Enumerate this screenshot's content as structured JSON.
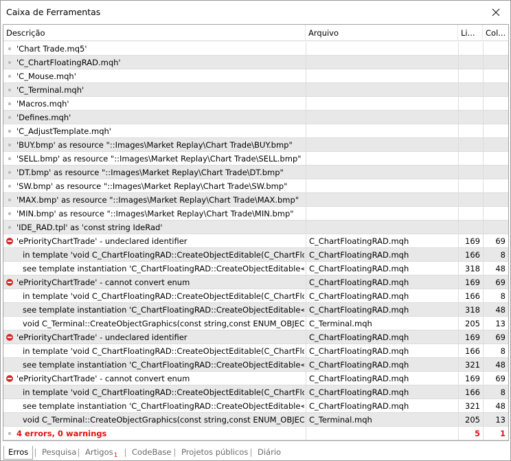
{
  "window": {
    "title": "Caixa de Ferramentas"
  },
  "columns": {
    "description": "Descrição",
    "file": "Arquivo",
    "line": "Li...",
    "col": "Col..."
  },
  "rows": [
    {
      "kind": "info",
      "bg": "white",
      "indent": false,
      "desc": "'Chart Trade.mq5'",
      "file": "",
      "line": "",
      "col": ""
    },
    {
      "kind": "info",
      "bg": "gray",
      "indent": false,
      "desc": "'C_ChartFloatingRAD.mqh'",
      "file": "",
      "line": "",
      "col": ""
    },
    {
      "kind": "info",
      "bg": "white",
      "indent": false,
      "desc": "'C_Mouse.mqh'",
      "file": "",
      "line": "",
      "col": ""
    },
    {
      "kind": "info",
      "bg": "gray",
      "indent": false,
      "desc": "'C_Terminal.mqh'",
      "file": "",
      "line": "",
      "col": ""
    },
    {
      "kind": "info",
      "bg": "white",
      "indent": false,
      "desc": "'Macros.mqh'",
      "file": "",
      "line": "",
      "col": ""
    },
    {
      "kind": "info",
      "bg": "gray",
      "indent": false,
      "desc": "'Defines.mqh'",
      "file": "",
      "line": "",
      "col": ""
    },
    {
      "kind": "info",
      "bg": "white",
      "indent": false,
      "desc": "'C_AdjustTemplate.mqh'",
      "file": "",
      "line": "",
      "col": ""
    },
    {
      "kind": "info",
      "bg": "gray",
      "indent": false,
      "desc": "'BUY.bmp' as resource \"::Images\\Market Replay\\Chart Trade\\BUY.bmp\"",
      "file": "",
      "line": "",
      "col": ""
    },
    {
      "kind": "info",
      "bg": "white",
      "indent": false,
      "desc": "'SELL.bmp' as resource \"::Images\\Market Replay\\Chart Trade\\SELL.bmp\"",
      "file": "",
      "line": "",
      "col": ""
    },
    {
      "kind": "info",
      "bg": "gray",
      "indent": false,
      "desc": "'DT.bmp' as resource \"::Images\\Market Replay\\Chart Trade\\DT.bmp\"",
      "file": "",
      "line": "",
      "col": ""
    },
    {
      "kind": "info",
      "bg": "white",
      "indent": false,
      "desc": "'SW.bmp' as resource \"::Images\\Market Replay\\Chart Trade\\SW.bmp\"",
      "file": "",
      "line": "",
      "col": ""
    },
    {
      "kind": "info",
      "bg": "gray",
      "indent": false,
      "desc": "'MAX.bmp' as resource \"::Images\\Market Replay\\Chart Trade\\MAX.bmp\"",
      "file": "",
      "line": "",
      "col": ""
    },
    {
      "kind": "info",
      "bg": "white",
      "indent": false,
      "desc": "'MIN.bmp' as resource \"::Images\\Market Replay\\Chart Trade\\MIN.bmp\"",
      "file": "",
      "line": "",
      "col": ""
    },
    {
      "kind": "info",
      "bg": "gray",
      "indent": false,
      "desc": "'IDE_RAD.tpl' as 'const string IdeRad'",
      "file": "",
      "line": "",
      "col": ""
    },
    {
      "kind": "error",
      "bg": "white",
      "indent": false,
      "desc": "'ePriorityChartTrade' - undeclared identifier",
      "file": "C_ChartFloatingRAD.mqh",
      "line": "169",
      "col": "69"
    },
    {
      "kind": "info",
      "bg": "gray",
      "indent": true,
      "desc": "in template 'void C_ChartFloatingRAD::CreateObjectEditable(C_ChartFloatin...",
      "file": "C_ChartFloatingRAD.mqh",
      "line": "166",
      "col": "8"
    },
    {
      "kind": "info",
      "bg": "white",
      "indent": true,
      "desc": "see template instantiation 'C_ChartFloatingRAD::CreateObjectEditable<shor...",
      "file": "C_ChartFloatingRAD.mqh",
      "line": "318",
      "col": "48"
    },
    {
      "kind": "error",
      "bg": "gray",
      "indent": false,
      "desc": "'ePriorityChartTrade' - cannot convert enum",
      "file": "C_ChartFloatingRAD.mqh",
      "line": "169",
      "col": "69"
    },
    {
      "kind": "info",
      "bg": "white",
      "indent": true,
      "desc": "in template 'void C_ChartFloatingRAD::CreateObjectEditable(C_ChartFloatin...",
      "file": "C_ChartFloatingRAD.mqh",
      "line": "166",
      "col": "8"
    },
    {
      "kind": "info",
      "bg": "gray",
      "indent": true,
      "desc": "see template instantiation 'C_ChartFloatingRAD::CreateObjectEditable<shor...",
      "file": "C_ChartFloatingRAD.mqh",
      "line": "318",
      "col": "48"
    },
    {
      "kind": "info",
      "bg": "white",
      "indent": true,
      "desc": "void C_Terminal::CreateObjectGraphics(const string,const ENUM_OBJECT,c...",
      "file": "C_Terminal.mqh",
      "line": "205",
      "col": "13"
    },
    {
      "kind": "error",
      "bg": "gray",
      "indent": false,
      "desc": "'ePriorityChartTrade' - undeclared identifier",
      "file": "C_ChartFloatingRAD.mqh",
      "line": "169",
      "col": "69"
    },
    {
      "kind": "info",
      "bg": "white",
      "indent": true,
      "desc": "in template 'void C_ChartFloatingRAD::CreateObjectEditable(C_ChartFloatin...",
      "file": "C_ChartFloatingRAD.mqh",
      "line": "166",
      "col": "8"
    },
    {
      "kind": "info",
      "bg": "gray",
      "indent": true,
      "desc": "see template instantiation 'C_ChartFloatingRAD::CreateObjectEditable<dou...",
      "file": "C_ChartFloatingRAD.mqh",
      "line": "321",
      "col": "48"
    },
    {
      "kind": "error",
      "bg": "white",
      "indent": false,
      "desc": "'ePriorityChartTrade' - cannot convert enum",
      "file": "C_ChartFloatingRAD.mqh",
      "line": "169",
      "col": "69"
    },
    {
      "kind": "info",
      "bg": "gray",
      "indent": true,
      "desc": "in template 'void C_ChartFloatingRAD::CreateObjectEditable(C_ChartFloatin...",
      "file": "C_ChartFloatingRAD.mqh",
      "line": "166",
      "col": "8"
    },
    {
      "kind": "info",
      "bg": "white",
      "indent": true,
      "desc": "see template instantiation 'C_ChartFloatingRAD::CreateObjectEditable<dou...",
      "file": "C_ChartFloatingRAD.mqh",
      "line": "321",
      "col": "48"
    },
    {
      "kind": "info",
      "bg": "gray",
      "indent": true,
      "desc": "void C_Terminal::CreateObjectGraphics(const string,const ENUM_OBJECT,c...",
      "file": "C_Terminal.mqh",
      "line": "205",
      "col": "13"
    },
    {
      "kind": "summary",
      "bg": "white",
      "indent": false,
      "desc": "4 errors, 0 warnings",
      "file": "",
      "line": "5",
      "col": "1"
    }
  ],
  "tabs": [
    {
      "label": "Erros",
      "active": true,
      "badge": ""
    },
    {
      "label": "Pesquisa",
      "active": false,
      "badge": ""
    },
    {
      "label": "Artigos",
      "active": false,
      "badge": "1"
    },
    {
      "label": "CodeBase",
      "active": false,
      "badge": ""
    },
    {
      "label": "Projetos públicos",
      "active": false,
      "badge": ""
    },
    {
      "label": "Diário",
      "active": false,
      "badge": ""
    }
  ],
  "colors": {
    "error": "#d52828",
    "summary_text": "#e01010",
    "row_gray": "#e8e8e8",
    "row_white": "#ffffff"
  },
  "icons": {
    "close": "close-icon",
    "error": "error-icon",
    "info": "bullet-icon"
  }
}
